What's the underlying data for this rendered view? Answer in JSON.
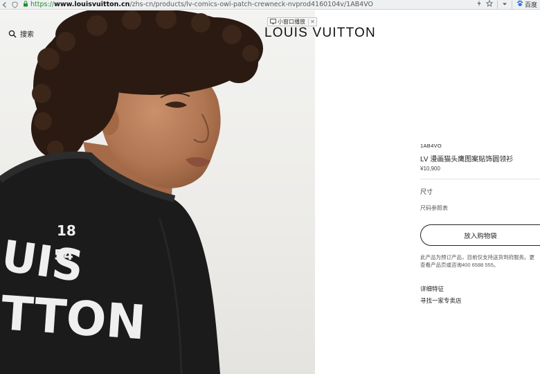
{
  "browser": {
    "url_scheme": "https://",
    "url_host": "www.louisvuitton.cn",
    "url_path": "/zhs-cn/products/lv-comics-owl-patch-crewneck-nvprod4160104v/1AB4VO",
    "search_engine_label": "百度",
    "icons": [
      "back-icon",
      "shield-icon",
      "lock-icon",
      "lightning-icon",
      "star-icon",
      "chevron-down-icon",
      "baidu-paw-icon"
    ]
  },
  "header": {
    "search_label": "搜索",
    "brand": "LOUIS VUITTON",
    "mini_player_label": "小窗口播放"
  },
  "hero": {
    "sweater_print": {
      "line1": "UIS",
      "line2": "TTON",
      "year_top": "18",
      "year_bottom": "54"
    }
  },
  "product": {
    "sku": "1AB4VO",
    "name": "LV 漫画猫头鹰图案贴饰圆领衫",
    "price": "¥10,900",
    "size_label": "尺寸",
    "size_guide": "尺码参照表",
    "add_to_cart": "放入购物袋",
    "note_line1": "此产品为预订产品，目前仅支持送货到府服务。更",
    "note_line2": "查看产品页或咨询400 6588 555。",
    "details_label": "详细特征",
    "find_store": "寻找一家专卖店"
  }
}
